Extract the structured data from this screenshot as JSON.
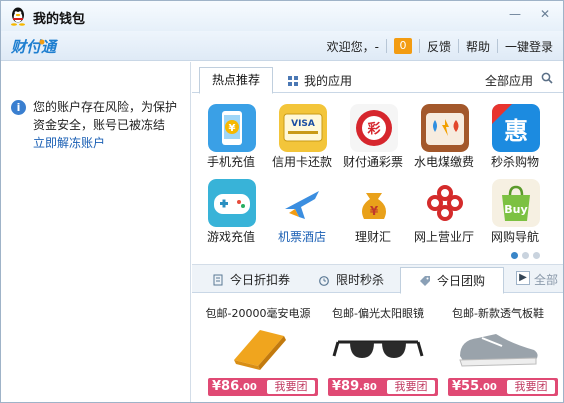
{
  "window": {
    "title": "我的钱包",
    "minimize_glyph": "—",
    "close_glyph": "✕"
  },
  "header": {
    "logo_text": "财付通",
    "welcome": "欢迎您，-",
    "badge_count": "0",
    "feedback": "反馈",
    "help": "帮助",
    "login": "一键登录"
  },
  "warning": {
    "text": "您的账户存在风险，为保护资金安全，账号已被冻结",
    "link": "立即解冻账户"
  },
  "tabs": {
    "hot": "热点推荐",
    "my_apps": "我的应用",
    "all_apps": "全部应用"
  },
  "apps": [
    {
      "label": "手机充值",
      "icon": "phone-recharge-icon"
    },
    {
      "label": "信用卡还款",
      "icon": "credit-card-icon"
    },
    {
      "label": "财付通彩票",
      "icon": "lottery-icon"
    },
    {
      "label": "水电煤缴费",
      "icon": "utility-bill-icon"
    },
    {
      "label": "秒杀购物",
      "icon": "flash-sale-icon"
    },
    {
      "label": "游戏充值",
      "icon": "game-controller-icon"
    },
    {
      "label": "机票酒店",
      "icon": "airplane-icon"
    },
    {
      "label": "理财汇",
      "icon": "money-bag-icon"
    },
    {
      "label": "网上营业厅",
      "icon": "china-unicom-icon"
    },
    {
      "label": "网购导航",
      "icon": "buy-bag-icon"
    }
  ],
  "deal_tabs": {
    "discount": "今日折扣券",
    "flash": "限时秒杀",
    "group": "今日团购",
    "more": "全部"
  },
  "products": [
    {
      "name": "包邮-20000毫安电源",
      "price_int": "86",
      "price_dec": ".00",
      "button": "我要团",
      "currency": "¥"
    },
    {
      "name": "包邮-偏光太阳眼镜",
      "price_int": "89",
      "price_dec": ".80",
      "button": "我要团",
      "currency": "¥"
    },
    {
      "name": "包邮-新款透气板鞋",
      "price_int": "55",
      "price_dec": ".00",
      "button": "我要团",
      "currency": "¥"
    }
  ],
  "colors": {
    "accent": "#3a86c8",
    "price_bar": "#e04a74",
    "badge": "#f39c12"
  }
}
